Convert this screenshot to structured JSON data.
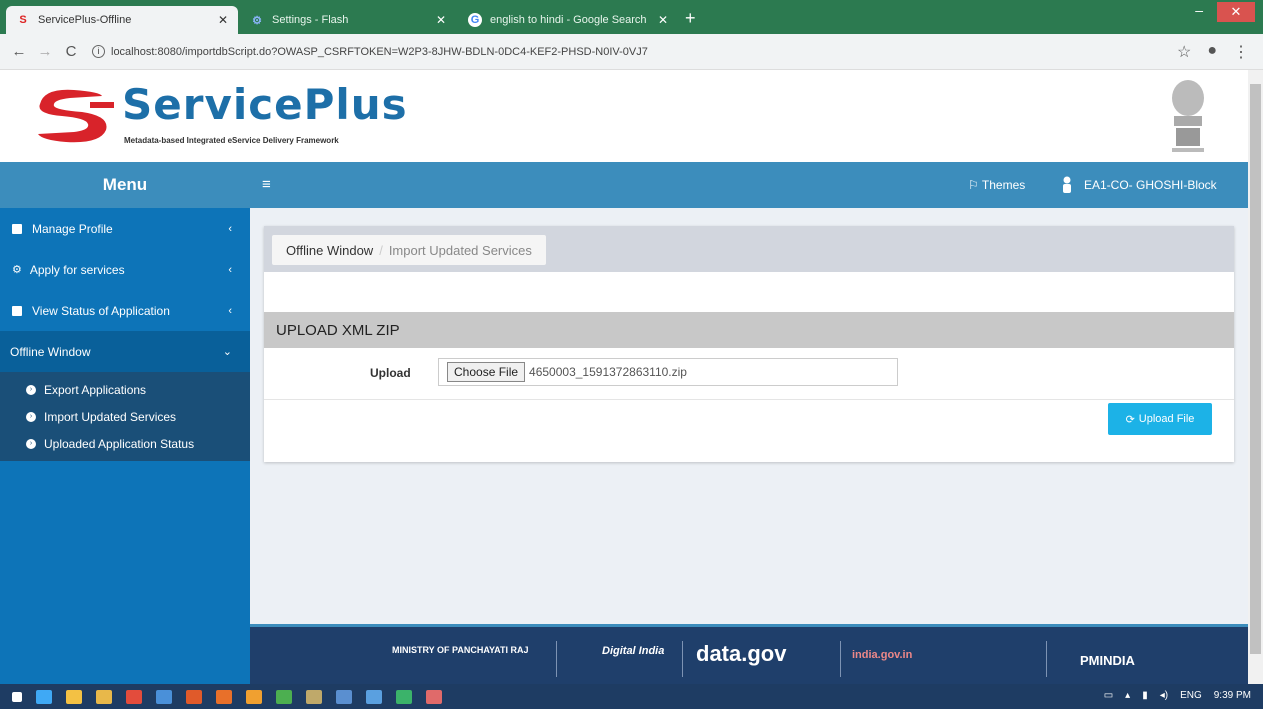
{
  "browser": {
    "tabs": [
      {
        "title": "ServicePlus-Offline",
        "favicon": "serviceplus-icon"
      },
      {
        "title": "Settings - Flash",
        "favicon": "gear-icon"
      },
      {
        "title": "english to hindi - Google Search",
        "favicon": "google-icon"
      }
    ],
    "new_tab": "+",
    "url": "localhost:8080/importdbScript.do?OWASP_CSRFTOKEN=W2P3-8JHW-BDLN-0DC4-KEF2-PHSD-N0IV-0VJ7"
  },
  "header": {
    "logo_text": "ServicePlus",
    "logo_subtitle": "Metadata-based Integrated eService Delivery Framework"
  },
  "nav": {
    "menu_label": "Menu",
    "themes_label": "Themes",
    "user_label": "EA1-CO- GHOSHI-Block"
  },
  "sidebar": {
    "items": [
      {
        "label": "Manage Profile",
        "icon": "profile-icon"
      },
      {
        "label": "Apply for services",
        "icon": "cogs-icon"
      },
      {
        "label": "View Status of Application",
        "icon": "status-icon"
      },
      {
        "label": "Offline Window",
        "icon": ""
      }
    ],
    "sub_items": [
      {
        "label": "Export Applications"
      },
      {
        "label": "Import Updated Services"
      },
      {
        "label": "Uploaded Application Status"
      }
    ]
  },
  "main": {
    "breadcrumb": {
      "parent": "Offline Window",
      "separator": "/",
      "current": "Import Updated Services"
    },
    "section_title": "UPLOAD XML ZIP",
    "upload_label": "Upload",
    "choose_file_label": "Choose File",
    "file_name": "4650003_1591372863110.zip",
    "upload_button": "Upload File"
  },
  "footer": {
    "logos": [
      "MINISTRY OF PANCHAYATI RAJ",
      "Digital India",
      "data.gov",
      "india.gov.in",
      "PMINDIA"
    ]
  },
  "taskbar": {
    "lang": "ENG",
    "time": "9:39 PM"
  },
  "colors": {
    "primary": "#3c8dbc",
    "sidebar": "#0d74b8",
    "sidebar_sub": "#1a4f78",
    "upload_button": "#1cb2e7",
    "footer": "#1f3f6b"
  }
}
